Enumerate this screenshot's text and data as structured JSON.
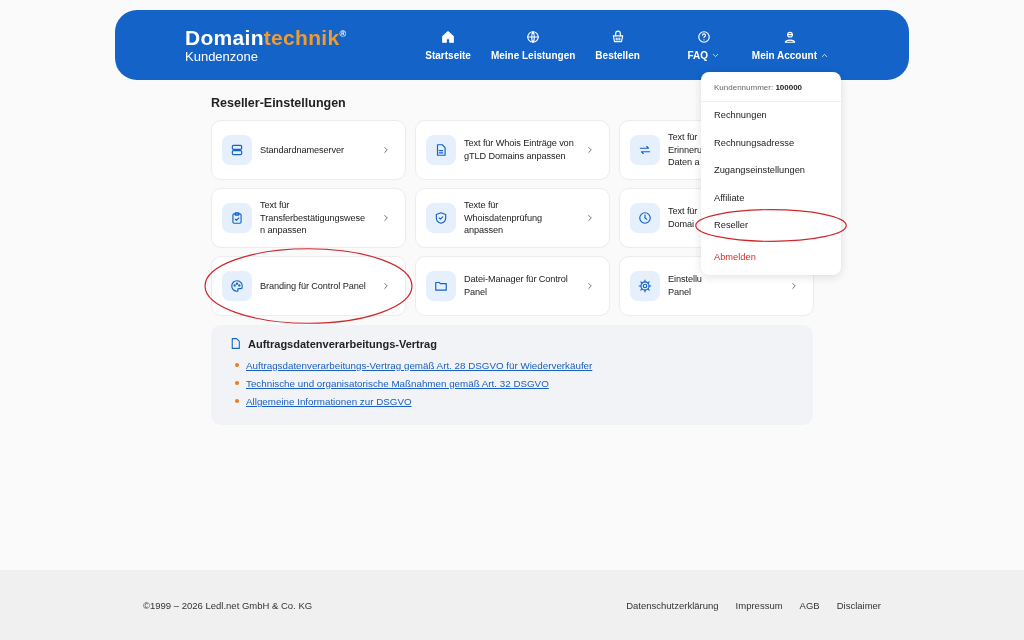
{
  "header": {
    "logo": {
      "word_1": "Domain",
      "word_2": "technik",
      "mark": "®",
      "subtitle": "Kundenzone"
    },
    "nav": [
      {
        "label": "Startseite",
        "kind": "link"
      },
      {
        "label": "Meine Leistungen",
        "kind": "link"
      },
      {
        "label": "Bestellen",
        "kind": "link"
      },
      {
        "label": "FAQ",
        "kind": "menu",
        "expanded": false
      },
      {
        "label": "Mein Account",
        "kind": "menu",
        "expanded": true
      }
    ]
  },
  "section_title": "Reseller-Einstellungen",
  "cards": [
    {
      "lines": [
        "Standardnameserver"
      ],
      "chevron": true,
      "highlighted": false
    },
    {
      "lines": [
        "Text für Whois Einträge von",
        "gTLD Domains anpassen"
      ],
      "chevron": true,
      "highlighted": false
    },
    {
      "lines": [
        "Text für",
        "Erinneru",
        "Daten a"
      ],
      "chevron": false,
      "highlighted": false
    },
    {
      "lines": [
        "Text für",
        "Transferbestätigungswese",
        "n anpassen"
      ],
      "chevron": true,
      "highlighted": false
    },
    {
      "lines": [
        "Texte für",
        "Whoisdatenprüfung",
        "anpassen"
      ],
      "chevron": true,
      "highlighted": false
    },
    {
      "lines": [
        "Text für",
        "Domai"
      ],
      "chevron": false,
      "highlighted": false
    },
    {
      "lines": [
        "Branding für Control Panel"
      ],
      "chevron": true,
      "highlighted": true
    },
    {
      "lines": [
        "Datei-Manager für Control",
        "Panel"
      ],
      "chevron": true,
      "highlighted": false
    },
    {
      "lines": [
        "Einstellu",
        "Panel"
      ],
      "chevron": true,
      "highlighted": false
    }
  ],
  "info": {
    "title": "Auftragsdatenverarbeitungs-Vertrag",
    "links": [
      "Auftragsdatenverarbeitungs-Vertrag gemäß Art. 28 DSGVO für Wiederverkäufer",
      "Technische und organisatorische Maßnahmen gemäß Art. 32 DSGVO",
      "Allgemeine Informationen zur DSGVO"
    ]
  },
  "account_menu": {
    "customer_number": "Kundennummer: **100000**",
    "items": [
      {
        "label": "Rechnungen",
        "kind": "normal",
        "highlighted": false
      },
      {
        "label": "Rechnungsadresse",
        "kind": "normal",
        "highlighted": false
      },
      {
        "label": "Zugangseinstellungen",
        "kind": "normal",
        "highlighted": false
      },
      {
        "label": "Affiliate",
        "kind": "normal",
        "highlighted": false
      },
      {
        "label": "Reseller",
        "kind": "normal",
        "highlighted": true
      },
      {
        "label": "Abmelden",
        "kind": "danger",
        "highlighted": false
      }
    ]
  },
  "footer": {
    "copyright": "©1999 – 2026 Ledl.net GmbH & Co. KG",
    "links": [
      "Datenschutzerklärung",
      "Impressum",
      "AGB",
      "Disclaimer"
    ]
  }
}
